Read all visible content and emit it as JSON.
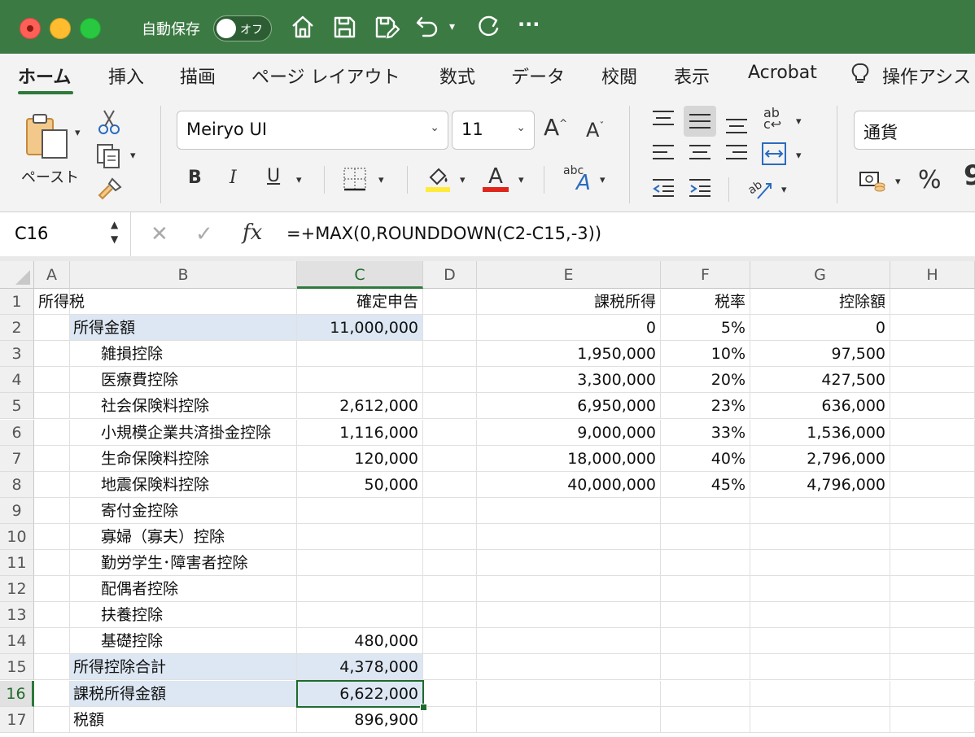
{
  "titlebar": {
    "autosave_label": "自動保存",
    "autosave_state": "オフ",
    "icons": [
      "home-icon",
      "save-icon",
      "edit-save-icon",
      "undo-icon",
      "redo-icon",
      "more-icon"
    ],
    "more_glyph": "···"
  },
  "tabs": [
    {
      "label": "ホーム",
      "active": true
    },
    {
      "label": "挿入"
    },
    {
      "label": "描画"
    },
    {
      "label": "ページ レイアウト"
    },
    {
      "label": "数式"
    },
    {
      "label": "データ"
    },
    {
      "label": "校閲"
    },
    {
      "label": "表示"
    },
    {
      "label": "Acrobat"
    },
    {
      "label": "操作アシス"
    }
  ],
  "ribbon": {
    "paste_label": "ペースト",
    "font_name": "Meiryo UI",
    "font_size": "11",
    "grow_font": "A",
    "shrink_font": "A",
    "bold": "B",
    "italic": "I",
    "underline": "U",
    "font_color_glyph": "A",
    "phonetic_glyph": "abc",
    "number_format": "通貨",
    "percent": "%",
    "comma": "9",
    "fill_color": "#ffeb3b",
    "font_color": "#e0261b"
  },
  "formula_bar": {
    "name_box": "C16",
    "cancel": "✕",
    "enter": "✓",
    "fx": "fx",
    "formula": "=+MAX(0,ROUNDDOWN(C2-C15,-3))"
  },
  "columns": [
    "A",
    "B",
    "C",
    "D",
    "E",
    "F",
    "G",
    "H"
  ],
  "selected_column": "C",
  "selected_row": "16",
  "rows": [
    {
      "n": "1",
      "A": "所得税",
      "C": "確定申告",
      "E": "課税所得",
      "F": "税率",
      "G": "控除額"
    },
    {
      "n": "2",
      "B": "所得金額",
      "C": "11,000,000",
      "E": "0",
      "F": "5%",
      "G": "0"
    },
    {
      "n": "3",
      "B": "雑損控除",
      "E": "1,950,000",
      "F": "10%",
      "G": "97,500"
    },
    {
      "n": "4",
      "B": "医療費控除",
      "E": "3,300,000",
      "F": "20%",
      "G": "427,500"
    },
    {
      "n": "5",
      "B": "社会保険料控除",
      "C": "2,612,000",
      "E": "6,950,000",
      "F": "23%",
      "G": "636,000"
    },
    {
      "n": "6",
      "B": "小規模企業共済掛金控除",
      "C": "1,116,000",
      "E": "9,000,000",
      "F": "33%",
      "G": "1,536,000"
    },
    {
      "n": "7",
      "B": "生命保険料控除",
      "C": "120,000",
      "E": "18,000,000",
      "F": "40%",
      "G": "2,796,000"
    },
    {
      "n": "8",
      "B": "地震保険料控除",
      "C": "50,000",
      "E": "40,000,000",
      "F": "45%",
      "G": "4,796,000"
    },
    {
      "n": "9",
      "B": "寄付金控除"
    },
    {
      "n": "10",
      "B": "寡婦（寡夫）控除"
    },
    {
      "n": "11",
      "B": "勤労学生･障害者控除"
    },
    {
      "n": "12",
      "B": "配偶者控除"
    },
    {
      "n": "13",
      "B": "扶養控除"
    },
    {
      "n": "14",
      "B": "基礎控除",
      "C": "480,000"
    },
    {
      "n": "15",
      "B": "所得控除合計",
      "C": "4,378,000"
    },
    {
      "n": "16",
      "B": "課税所得金額",
      "C": "6,622,000"
    },
    {
      "n": "17",
      "B": "税額",
      "C": "896,900"
    }
  ],
  "colors": {
    "titlebar": "#3c7a43",
    "accent": "#2d7a3a",
    "highlight_fill": "#dde7f3"
  }
}
